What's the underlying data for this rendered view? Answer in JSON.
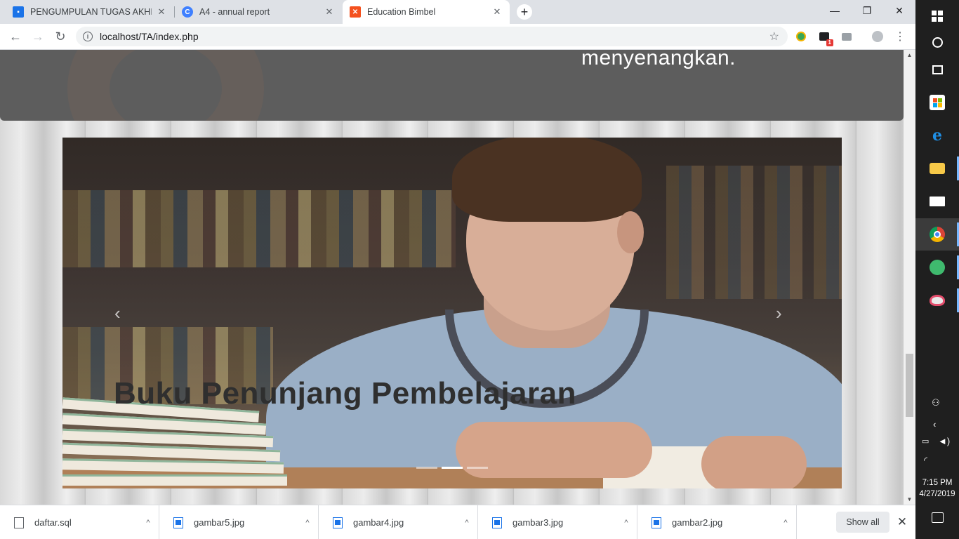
{
  "tabs": [
    {
      "title": "PENGUMPULAN TUGAS AKHIR W",
      "favicon": "classroom-icon",
      "color": "#1a73e8"
    },
    {
      "title": "A4 - annual report",
      "favicon": "canva-icon",
      "color": "#3f80ff"
    },
    {
      "title": "Education Bimbel",
      "favicon": "xampp-icon",
      "color": "#f4511e"
    }
  ],
  "tab_close": "✕",
  "new_tab": "+",
  "window_controls": {
    "minimize": "—",
    "maximize": "❐",
    "close": "✕"
  },
  "toolbar": {
    "back": "←",
    "forward": "→",
    "reload": "↻",
    "url": "localhost/TA/index.php",
    "info": "i",
    "star": "☆",
    "ext_badge": "1",
    "menu": "⋮"
  },
  "page": {
    "banner_text": "menyenangkan.",
    "carousel": {
      "caption": "Buku Penunjang Pembelajaran",
      "prev": "‹",
      "next": "›",
      "slide_count": 3,
      "active_index": 1
    }
  },
  "downloads": {
    "items": [
      {
        "name": "daftar.sql",
        "type": "file"
      },
      {
        "name": "gambar5.jpg",
        "type": "image"
      },
      {
        "name": "gambar4.jpg",
        "type": "image"
      },
      {
        "name": "gambar3.jpg",
        "type": "image"
      },
      {
        "name": "gambar2.jpg",
        "type": "image"
      }
    ],
    "caret": "^",
    "show_all": "Show all",
    "close": "✕"
  },
  "taskbar": {
    "clock_time": "7:15 PM",
    "clock_date": "4/27/2019",
    "apps": [
      "search-cortana",
      "task-view",
      "microsoft-store",
      "edge",
      "file-explorer",
      "mail",
      "chrome",
      "atom",
      "paint"
    ]
  }
}
